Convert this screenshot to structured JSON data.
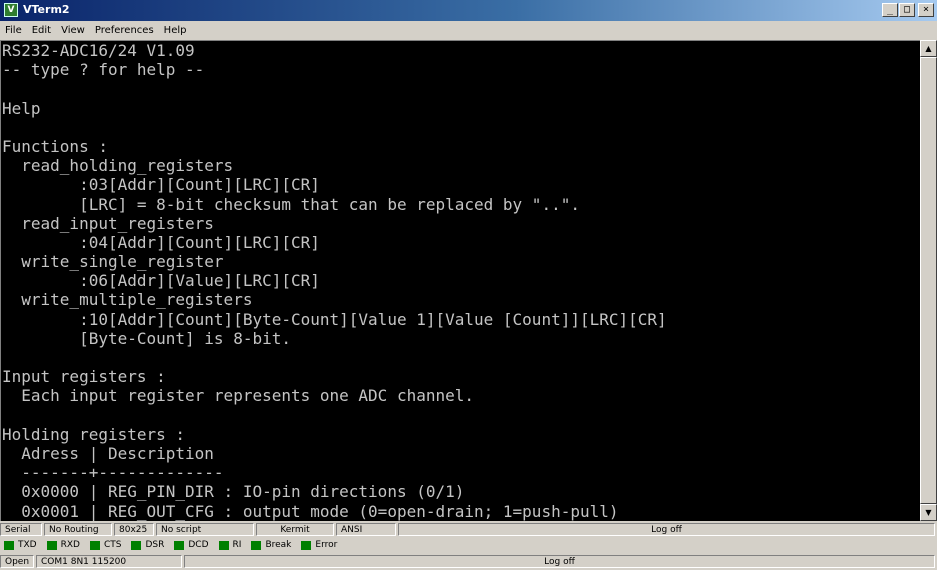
{
  "window": {
    "title": "VTerm2",
    "controls": {
      "minimize": "_",
      "maximize": "□",
      "close": "×"
    }
  },
  "menu": [
    "File",
    "Edit",
    "View",
    "Preferences",
    "Help"
  ],
  "terminal": {
    "background": "#000000",
    "foreground": "#c4c4c4",
    "lines": [
      "RS232-ADC16/24 V1.09",
      "-- type ? for help --",
      "",
      "Help",
      "",
      "Functions :",
      "  read_holding_registers",
      "        :03[Addr][Count][LRC][CR]",
      "        [LRC] = 8-bit checksum that can be replaced by \"..\".",
      "  read_input_registers",
      "        :04[Addr][Count][LRC][CR]",
      "  write_single_register",
      "        :06[Addr][Value][LRC][CR]",
      "  write_multiple_registers",
      "        :10[Addr][Count][Byte-Count][Value 1][Value [Count]][LRC][CR]",
      "        [Byte-Count] is 8-bit.",
      "",
      "Input registers :",
      "  Each input register represents one ADC channel.",
      "",
      "Holding registers :",
      "  Adress | Description",
      "  -------+-------------",
      "  0x0000 | REG_PIN_DIR : IO-pin directions (0/1)",
      "  0x0001 | REG_OUT_CFG : output mode (0=open-drain; 1=push-pull)"
    ]
  },
  "scrollbar": {
    "up": "▲",
    "down": "▼"
  },
  "status_row1": {
    "mode": "Serial",
    "routing": "No Routing",
    "size": "80x25",
    "script": "No script",
    "protocol": "Kermit",
    "emulation": "ANSI",
    "log": "Log off"
  },
  "signals": {
    "led_color": "#008000",
    "items": [
      "TXD",
      "RXD",
      "CTS",
      "DSR",
      "DCD",
      "RI",
      "Break",
      "Error"
    ]
  },
  "status_row3": {
    "state": "Open",
    "port": "COM1 8N1 115200",
    "log": "Log off"
  }
}
